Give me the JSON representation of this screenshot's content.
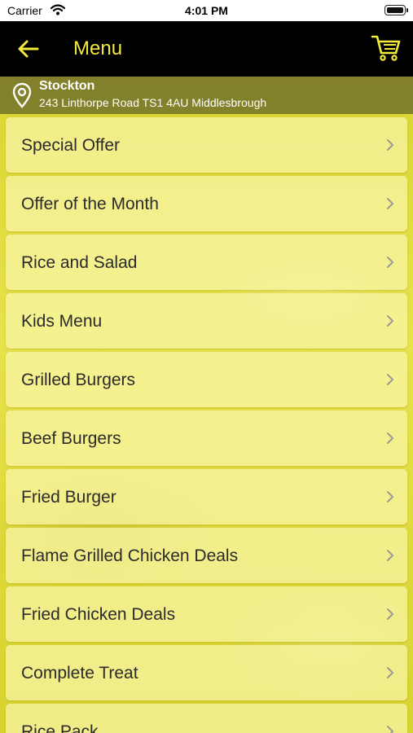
{
  "status_bar": {
    "carrier": "Carrier",
    "time": "4:01 PM"
  },
  "nav": {
    "title": "Menu",
    "back_icon": "arrow-left-icon",
    "cart_icon": "shopping-cart-icon",
    "accent_color": "#f3ea3a",
    "background_color": "#000000"
  },
  "location": {
    "icon": "location-pin-icon",
    "name": "Stockton",
    "address": "243 Linthorpe Road TS1 4AU Middlesbrough"
  },
  "menu": {
    "items": [
      {
        "label": "Special Offer"
      },
      {
        "label": "Offer of the Month"
      },
      {
        "label": "Rice and Salad"
      },
      {
        "label": "Kids Menu"
      },
      {
        "label": "Grilled Burgers"
      },
      {
        "label": "Beef Burgers"
      },
      {
        "label": "Fried Burger"
      },
      {
        "label": "Flame Grilled Chicken Deals"
      },
      {
        "label": "Fried Chicken Deals"
      },
      {
        "label": "Complete Treat"
      },
      {
        "label": "Rice Pack"
      }
    ],
    "chevron_icon": "chevron-right-icon",
    "background_color": "#e2dd3f"
  }
}
